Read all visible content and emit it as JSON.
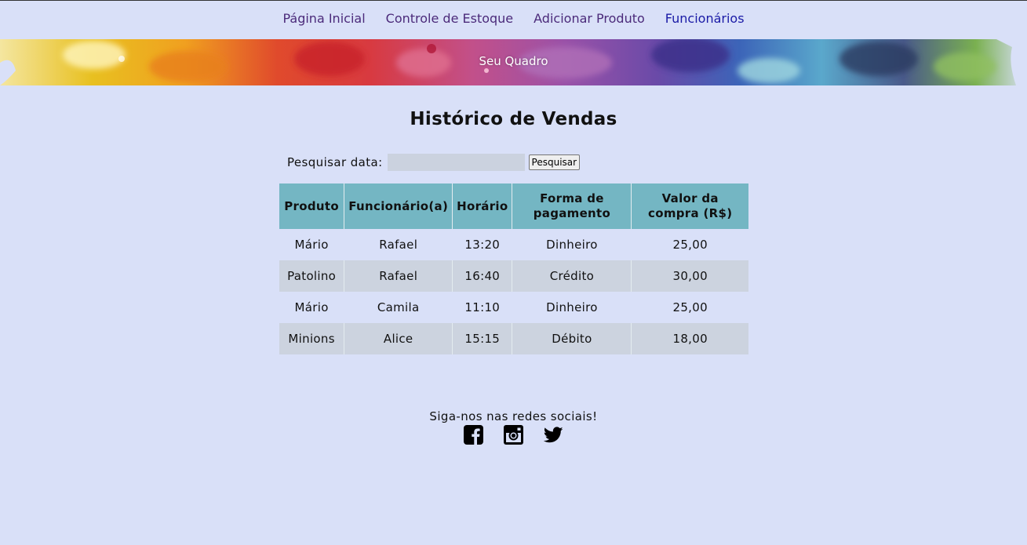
{
  "nav": {
    "items": [
      {
        "label": "Página Inicial"
      },
      {
        "label": "Controle de Estoque"
      },
      {
        "label": "Adicionar Produto"
      },
      {
        "label": "Funcionários"
      }
    ]
  },
  "banner": {
    "brand": "Seu Quadro"
  },
  "page": {
    "title": "Histórico de Vendas"
  },
  "search": {
    "label": "Pesquisar data:",
    "value": "",
    "button_label": "Pesquisar"
  },
  "table": {
    "headers": [
      "Produto",
      "Funcionário(a)",
      "Horário",
      "Forma de pagamento",
      "Valor da compra (R$)"
    ],
    "rows": [
      [
        "Mário",
        "Rafael",
        "13:20",
        "Dinheiro",
        "25,00"
      ],
      [
        "Patolino",
        "Rafael",
        "16:40",
        "Crédito",
        "30,00"
      ],
      [
        "Mário",
        "Camila",
        "11:10",
        "Dinheiro",
        "25,00"
      ],
      [
        "Minions",
        "Alice",
        "15:15",
        "Débito",
        "18,00"
      ]
    ]
  },
  "footer": {
    "text": "Siga-nos nas redes sociais!",
    "icons": [
      "facebook-icon",
      "instagram-icon",
      "twitter-icon"
    ]
  },
  "colors": {
    "background": "#d9e0f8",
    "table_header": "#74b6c3",
    "table_row_alt": "#ccd3df",
    "nav_link": "#4b2a7a",
    "nav_active": "#1a1aa6"
  }
}
